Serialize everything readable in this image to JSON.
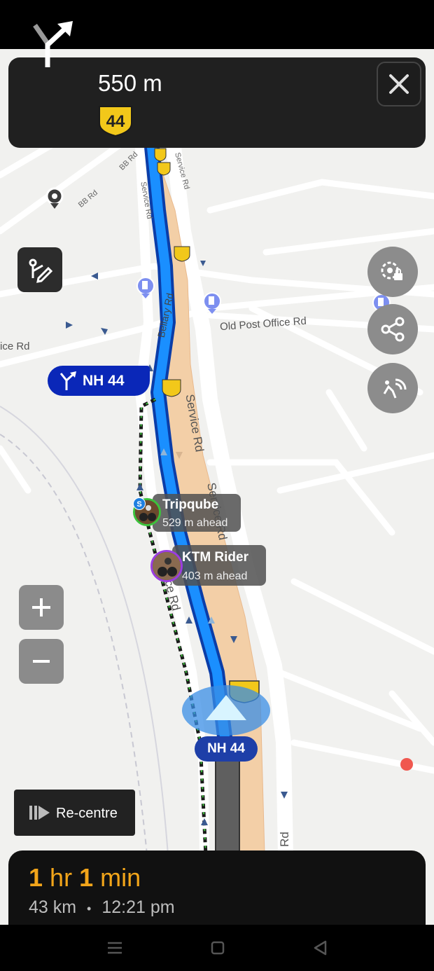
{
  "instruction": {
    "distance": "550 m",
    "route_number": "44"
  },
  "map": {
    "labels": {
      "bb_rd_1": "BB Rd",
      "bb_rd_2": "BB Rd",
      "service_rd_1": "Service Rd",
      "service_rd_2": "Service Rd",
      "bellary_rd": "Bellary Rd",
      "old_post_office_rd": "Old Post Office Rd",
      "ice_rd": "ice Rd",
      "service_rd_big": "Service Rd",
      "serviced_rd": "Service Rd",
      "vice_rd": "vice Rd",
      "rd_bottom": "Rd"
    },
    "shield_number": "44"
  },
  "turn_callout": {
    "label": "NH 44"
  },
  "riders": [
    {
      "name": "Tripqube",
      "distance": "529 m ahead",
      "badge": "S",
      "ring_color": "#3cc23c"
    },
    {
      "name": "KTM Rider",
      "distance": "403 m ahead",
      "ring_color": "#9b3ee0"
    }
  ],
  "current_road": "NH 44",
  "recentre_label": "Re-centre",
  "eta": {
    "hours": "1",
    "hours_unit": "hr",
    "minutes": "1",
    "minutes_unit": "min",
    "distance": "43 km",
    "separator": "•",
    "arrival_time": "12:21 pm"
  },
  "colors": {
    "route_blue": "#1a8fff",
    "route_outline": "#0b3da8",
    "highway_fill": "#f3cfa7",
    "eta_accent": "#f2a51a",
    "callout_blue": "#0a27b8"
  }
}
